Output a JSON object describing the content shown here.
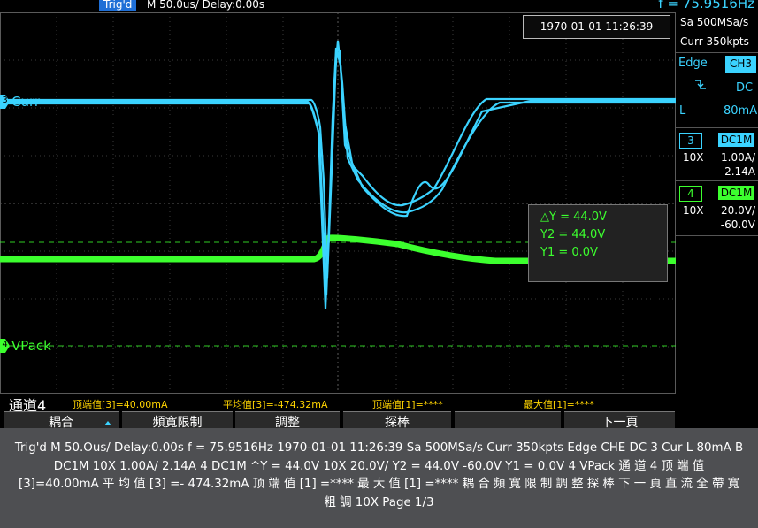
{
  "topbar": {
    "trig_status": "Trig'd",
    "timebase": "M 50.0us/  Delay:0.00s",
    "frequency": "f = 75.9516Hz"
  },
  "timestamp": "1970-01-01 11:26:39",
  "right_panel": {
    "sample_rate": "Sa 500MSa/s",
    "memory_depth": "Curr 350kpts",
    "trigger": {
      "type": "Edge",
      "source": "CH3",
      "slope_icon": "rising-falling-edge-icon",
      "coupling": "DC",
      "level_prefix": "L",
      "level": "80mA"
    },
    "channels": [
      {
        "num": "3",
        "coupling": "DC1M",
        "probe": "10X",
        "scale": "1.00A/",
        "offset": "2.14A",
        "color": "#3bd3ff"
      },
      {
        "num": "4",
        "coupling": "DC1M",
        "probe": "10X",
        "scale": "20.0V/",
        "offset": "-60.0V",
        "color": "#3cff2e"
      }
    ]
  },
  "cursors": {
    "delta_y": "△Y = 44.0V",
    "y2": "Y2 = 44.0V",
    "y1": "Y1 = 0.0V"
  },
  "channel_labels": {
    "ch3": {
      "num": "3",
      "name": "Curr"
    },
    "ch4": {
      "num": "4",
      "name": "VPack"
    }
  },
  "measurements": {
    "channel": "通道4",
    "items": [
      "顶端值[3]=40.00mA",
      "平均值[3]=-474.32mA",
      "顶端值[1]=****",
      "最大值[1]=****"
    ]
  },
  "softkeys": [
    "耦合",
    "頻寬限制",
    "調整",
    "探棒",
    "",
    "下一頁"
  ],
  "caption": "Trig'd M 50.Ous/ Delay:0.00s f = 75.9516Hz 1970-01-01 11:26:39 Sa 500MSa/s Curr 350kpts Edge CHE DC 3 Cur L 80mA B DC1M 10X 1.00A/ 2.14A 4 DC1M ^Y = 44.0V 10X 20.0V/ Y2 = 44.0V -60.0V Y1 = 0.0V 4 VPack 通 道 4 顶 端 值 [3]=40.00mA 平 均 值 [3] =- 474.32mA 顶 端 值 [1] =**** 最 大 值 [1] =**** 耦 合 頻 寬 限 制 調 整 探 棒 下 一 頁 直 流 全 帶 寬 粗 調 10X Page 1/3",
  "colors": {
    "ch3": "#3bd3ff",
    "ch4": "#3cff2e",
    "measure": "#ffd400",
    "trig_badge": "#1f6fd6",
    "caption_bg": "#4e4f52"
  }
}
